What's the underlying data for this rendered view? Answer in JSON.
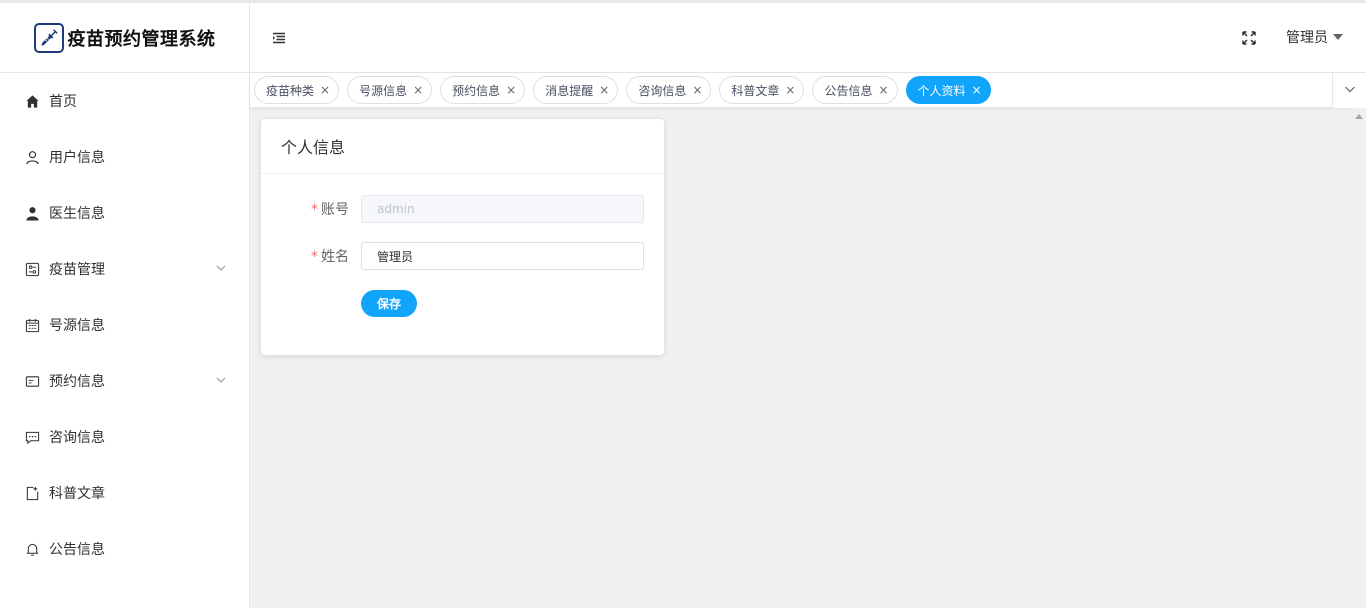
{
  "app": {
    "title": "疫苗预约管理系统",
    "logo_icon": "syringe-icon"
  },
  "sidebar": {
    "items": [
      {
        "label": "首页",
        "icon": "home-icon",
        "has_children": false
      },
      {
        "label": "用户信息",
        "icon": "user-outline-icon",
        "has_children": false
      },
      {
        "label": "医生信息",
        "icon": "user-filled-icon",
        "has_children": false
      },
      {
        "label": "疫苗管理",
        "icon": "sliders-icon",
        "has_children": true
      },
      {
        "label": "号源信息",
        "icon": "calendar-icon",
        "has_children": false
      },
      {
        "label": "预约信息",
        "icon": "id-card-icon",
        "has_children": true
      },
      {
        "label": "咨询信息",
        "icon": "chat-icon",
        "has_children": false
      },
      {
        "label": "科普文章",
        "icon": "document-icon",
        "has_children": false
      },
      {
        "label": "公告信息",
        "icon": "bell-icon",
        "has_children": false
      }
    ]
  },
  "header": {
    "user_name": "管理员"
  },
  "tags": [
    {
      "label": "疫苗种类",
      "active": false
    },
    {
      "label": "号源信息",
      "active": false
    },
    {
      "label": "预约信息",
      "active": false
    },
    {
      "label": "消息提醒",
      "active": false
    },
    {
      "label": "咨询信息",
      "active": false
    },
    {
      "label": "科普文章",
      "active": false
    },
    {
      "label": "公告信息",
      "active": false
    },
    {
      "label": "个人资料",
      "active": true
    }
  ],
  "tag_close_glyph": "×",
  "profile": {
    "card_title": "个人信息",
    "required_mark": "*",
    "account_label": "账号",
    "account_value": "admin",
    "name_label": "姓名",
    "name_value": "管理员",
    "save_label": "保存"
  },
  "colors": {
    "primary": "#10a4fb",
    "required": "#f56c6c",
    "logo_border": "#1f3a7a"
  }
}
